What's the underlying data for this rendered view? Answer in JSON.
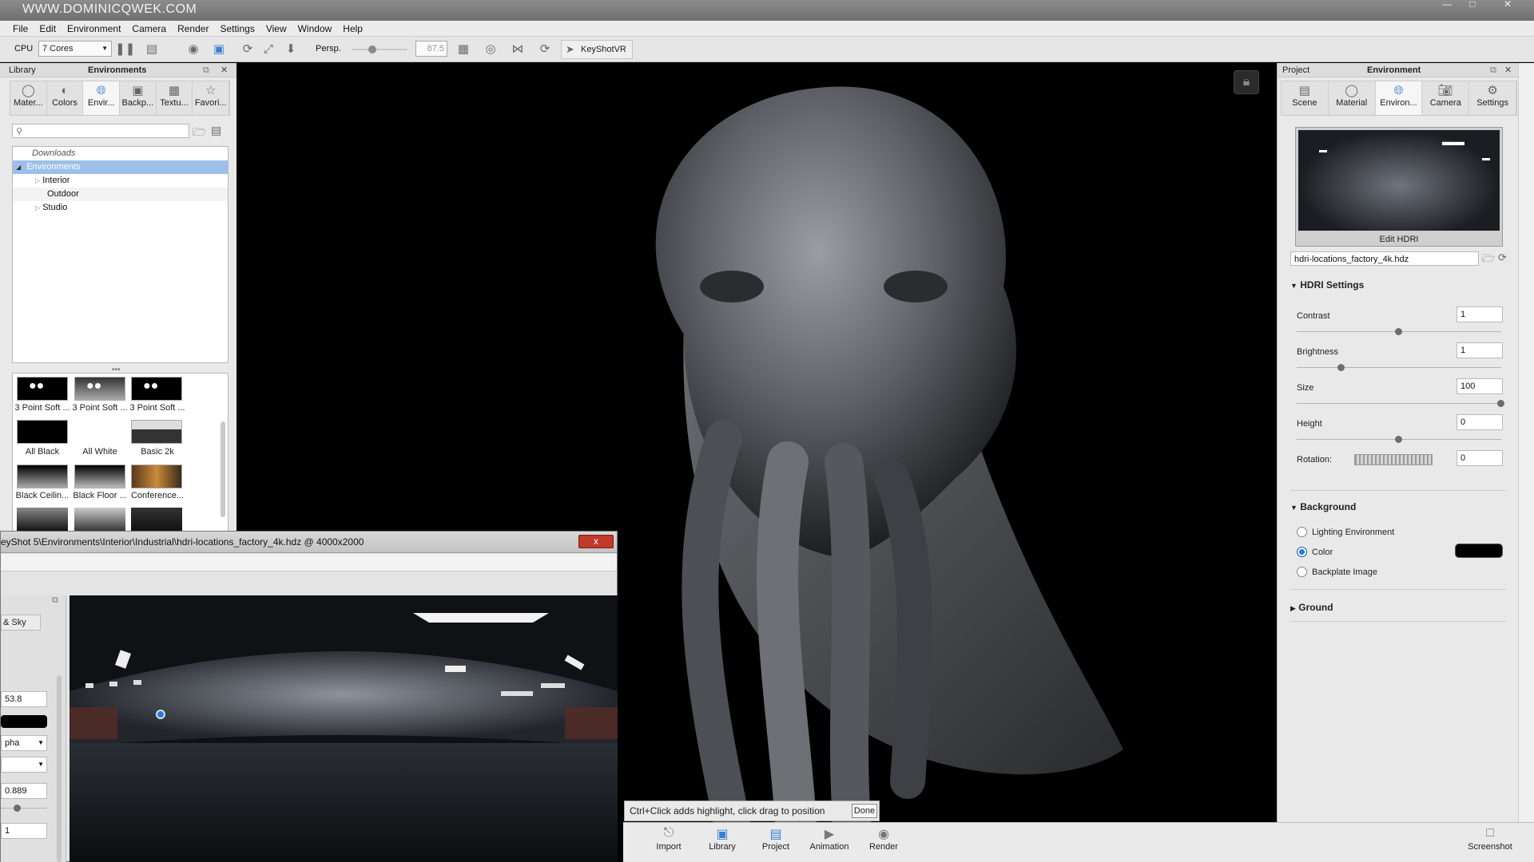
{
  "window": {
    "watermark": "WWW.DOMINICQWEK.COM"
  },
  "menu": [
    "File",
    "Edit",
    "Environment",
    "Camera",
    "Render",
    "Settings",
    "View",
    "Window",
    "Help"
  ],
  "toolbar": {
    "cpu_label": "CPU",
    "cores": "7 Cores",
    "persp_label": "Persp.",
    "fov_value": "87.5",
    "keyshotvr_label": "KeyShotVR"
  },
  "library": {
    "title_left": "Library",
    "title_center": "Environments",
    "tabs": [
      {
        "label": "Mater...",
        "icon": "material-sphere-icon"
      },
      {
        "label": "Colors",
        "icon": "color-swatch-icon"
      },
      {
        "label": "Envir...",
        "icon": "globe-icon"
      },
      {
        "label": "Backp...",
        "icon": "backplate-icon"
      },
      {
        "label": "Textu...",
        "icon": "texture-icon"
      },
      {
        "label": "Favori...",
        "icon": "star-icon"
      }
    ],
    "tree": {
      "downloads": "Downloads",
      "environments": "Environments",
      "children": [
        "Interior",
        "Outdoor",
        "Studio"
      ]
    },
    "thumbnails": [
      "3 Point Soft ...",
      "3 Point Soft ...",
      "3 Point Soft ...",
      "All Black",
      "All White",
      "Basic 2k",
      "Black Ceilin...",
      "Black Floor ...",
      "Conference..."
    ]
  },
  "project": {
    "title_left": "Project",
    "title_center": "Environment",
    "tabs": [
      {
        "label": "Scene",
        "icon": "scene-icon"
      },
      {
        "label": "Material",
        "icon": "material-sphere-icon"
      },
      {
        "label": "Environ...",
        "icon": "globe-icon"
      },
      {
        "label": "Camera",
        "icon": "camera-icon"
      },
      {
        "label": "Settings",
        "icon": "gear-icon"
      }
    ],
    "edit_hdri": "Edit HDRI",
    "hdri_file": "hdri-locations_factory_4k.hdz",
    "hdri_settings_title": "HDRI Settings",
    "props": [
      {
        "label": "Contrast",
        "value": "1",
        "level": 0.5
      },
      {
        "label": "Brightness",
        "value": "1",
        "level": 0.22
      },
      {
        "label": "Size",
        "value": "100",
        "level": 1.0
      },
      {
        "label": "Height",
        "value": "0",
        "level": 0.5
      }
    ],
    "rotation_label": "Rotation:",
    "rotation_value": "0",
    "background_title": "Background",
    "bg_options": [
      "Lighting Environment",
      "Color",
      "Backplate Image"
    ],
    "bg_selected": "Color",
    "bg_color": "#000000",
    "ground_title": "Ground"
  },
  "viewport": {
    "hint": "Ctrl+Click adds highlight, click drag to position",
    "done_label": "Done"
  },
  "hdri_editor": {
    "title": "eyShot 5\\Environments\\Interior\\Industrial\\hdri-locations_factory_4k.hdz @ 4000x2000",
    "close_label": "x",
    "tab_label": "& Sky",
    "value1": "53.8",
    "dropdown1": "pha",
    "value2": "0.889",
    "value3": "1"
  },
  "dock": [
    {
      "label": "Import",
      "icon": "import-icon"
    },
    {
      "label": "Library",
      "icon": "library-icon"
    },
    {
      "label": "Project",
      "icon": "project-icon"
    },
    {
      "label": "Animation",
      "icon": "animation-icon"
    },
    {
      "label": "Render",
      "icon": "render-icon"
    },
    {
      "label": "Screenshot",
      "icon": "screenshot-icon"
    }
  ],
  "colors": {
    "accent": "#3b7fd3",
    "viewport_bg": "#000000",
    "close_red": "#c0392b"
  }
}
